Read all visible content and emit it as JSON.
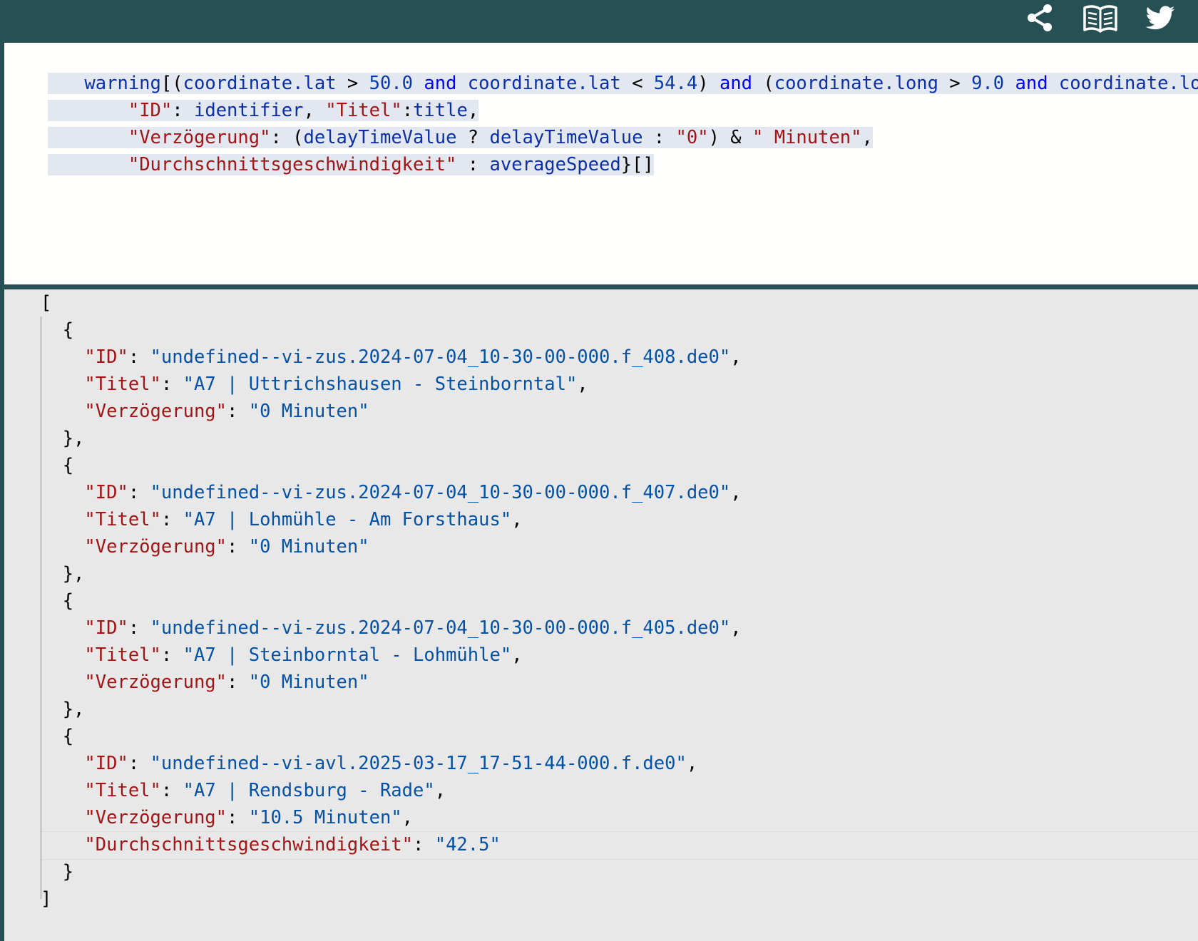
{
  "toolbar": {
    "icons": [
      "share-icon",
      "documentation-icon",
      "twitter-icon"
    ],
    "background": "#275055"
  },
  "query": {
    "line1": {
      "a": "warning",
      "b": "[(",
      "c": "coordinate.lat",
      "d": " > ",
      "e": "50.0",
      "f": " and ",
      "g": "coordinate.lat",
      "h": " < ",
      "i": "54.4",
      "j": ") ",
      "k": "and",
      "l": " (",
      "m": "coordinate.long",
      "n": " > ",
      "o": "9.0",
      "p": " and ",
      "q": "coordinate.long",
      "r": " <"
    },
    "line2": {
      "a": "\"ID\"",
      "b": ": ",
      "c": "identifier",
      "d": ", ",
      "e": "\"Titel\"",
      "f": ":",
      "g": "title",
      "h": ","
    },
    "line3": {
      "a": "\"Verzögerung\"",
      "b": ": (",
      "c": "delayTimeValue",
      "d": " ? ",
      "e": "delayTimeValue",
      "f": " : ",
      "g": "\"0\"",
      "h": ") & ",
      "i": "\" Minuten\"",
      "j": ","
    },
    "line4": {
      "a": "\"Durchschnittsgeschwindigkeit\"",
      "b": " : ",
      "c": "averageSpeed",
      "d": "}[]"
    }
  },
  "result": {
    "open": "[",
    "close": "]",
    "items": [
      {
        "id_key": "\"ID\"",
        "id_val": "\"undefined--vi-zus.2024-07-04_10-30-00-000.f_408.de0\"",
        "title_key": "\"Titel\"",
        "title_val": "\"A7 | Uttrichshausen - Steinborntal\"",
        "delay_key": "\"Verzögerung\"",
        "delay_val": "\"0 Minuten\""
      },
      {
        "id_key": "\"ID\"",
        "id_val": "\"undefined--vi-zus.2024-07-04_10-30-00-000.f_407.de0\"",
        "title_key": "\"Titel\"",
        "title_val": "\"A7 | Lohmühle - Am Forsthaus\"",
        "delay_key": "\"Verzögerung\"",
        "delay_val": "\"0 Minuten\""
      },
      {
        "id_key": "\"ID\"",
        "id_val": "\"undefined--vi-zus.2024-07-04_10-30-00-000.f_405.de0\"",
        "title_key": "\"Titel\"",
        "title_val": "\"A7 | Steinborntal - Lohmühle\"",
        "delay_key": "\"Verzögerung\"",
        "delay_val": "\"0 Minuten\""
      },
      {
        "id_key": "\"ID\"",
        "id_val": "\"undefined--vi-avl.2025-03-17_17-51-44-000.f.de0\"",
        "title_key": "\"Titel\"",
        "title_val": "\"A7 | Rendsburg - Rade\"",
        "delay_key": "\"Verzögerung\"",
        "delay_val": "\"10.5 Minuten\"",
        "speed_key": "\"Durchschnittsgeschwindigkeit\"",
        "speed_val": "\"42.5\""
      }
    ]
  }
}
